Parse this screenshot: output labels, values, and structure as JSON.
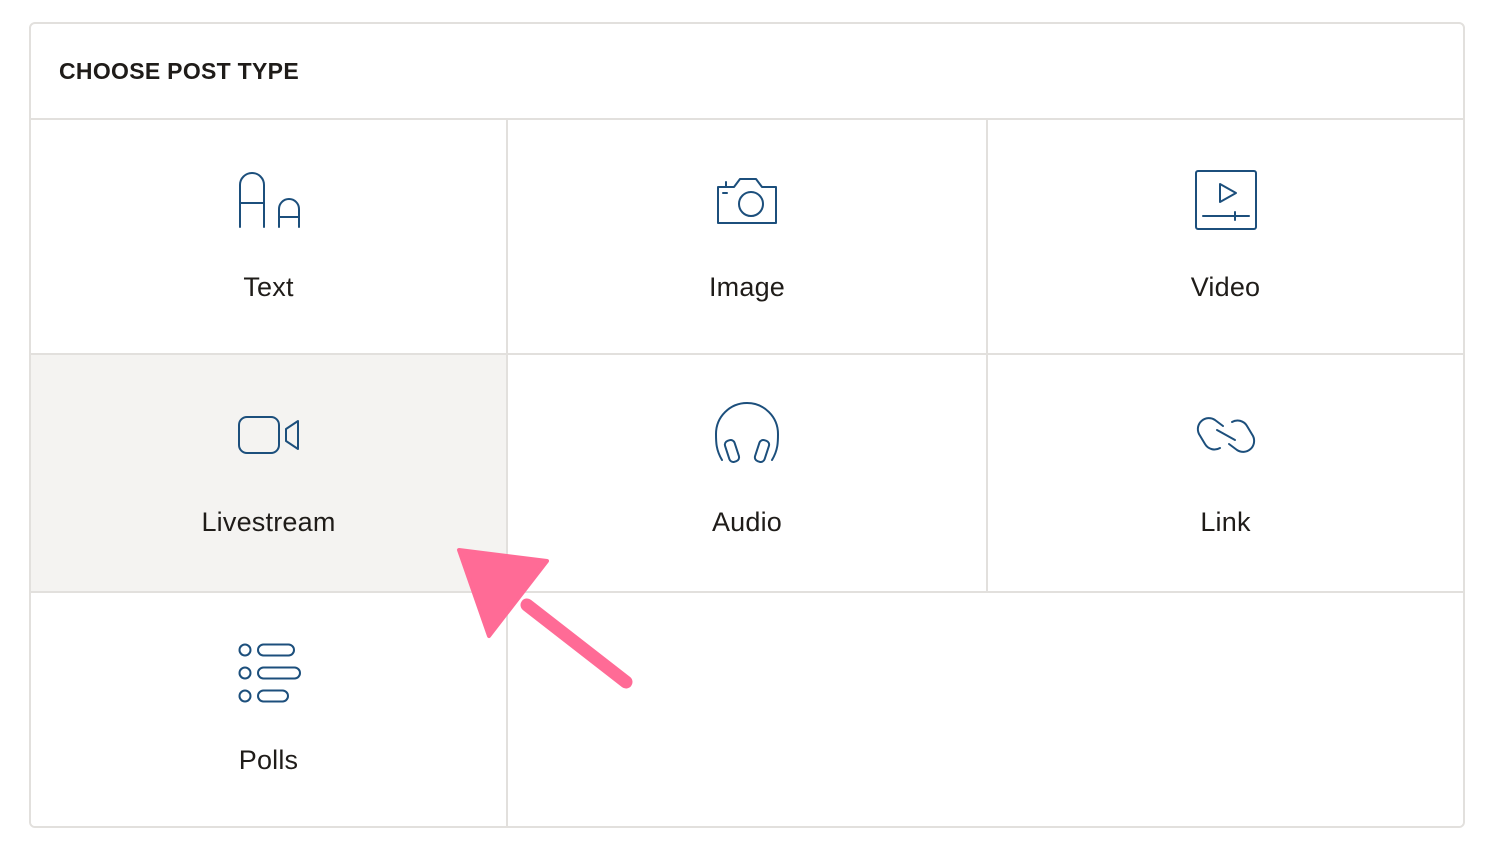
{
  "header": {
    "title": "CHOOSE POST TYPE"
  },
  "post_types": [
    {
      "label": "Text",
      "icon": "text-icon",
      "selected": false
    },
    {
      "label": "Image",
      "icon": "camera-icon",
      "selected": false
    },
    {
      "label": "Video",
      "icon": "video-player-icon",
      "selected": false
    },
    {
      "label": "Livestream",
      "icon": "livestream-camera-icon",
      "selected": true
    },
    {
      "label": "Audio",
      "icon": "headphones-icon",
      "selected": false
    },
    {
      "label": "Link",
      "icon": "link-icon",
      "selected": false
    },
    {
      "label": "Polls",
      "icon": "polls-list-icon",
      "selected": false
    }
  ],
  "colors": {
    "icon_stroke": "#1c4f7c",
    "selected_background": "#f4f3f1",
    "border": "#e2e0dd",
    "annotation_arrow": "#ff6b96"
  }
}
